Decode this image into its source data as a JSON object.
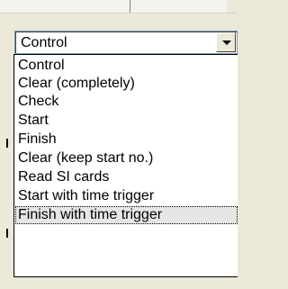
{
  "combo": {
    "value": "Control",
    "open": true
  },
  "dropdown": {
    "items": [
      "Control",
      "Clear (completely)",
      "Check",
      "Start",
      "Finish",
      "Clear (keep start no.)",
      "Read SI cards",
      "Start with time trigger",
      "Finish with time trigger"
    ],
    "highlighted_item": "Finish with time trigger"
  },
  "colors": {
    "window_background": "#ece9d8",
    "list_background": "#ffffff",
    "text": "#000000"
  },
  "icons": {
    "combo_arrow": "chevron-down-icon"
  }
}
